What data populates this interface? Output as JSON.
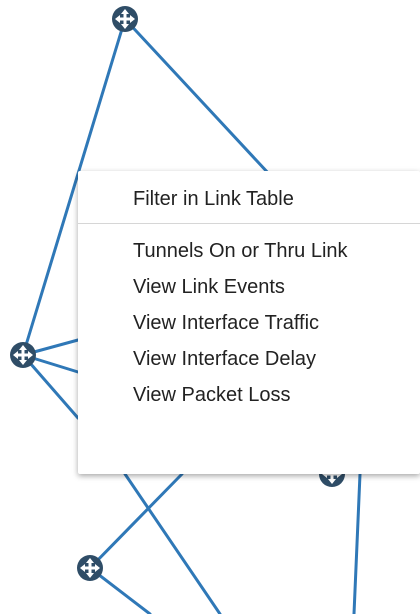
{
  "topology": {
    "link_color": "#2f78b7",
    "router_color": "#2f4d67",
    "router_icon": "router-icon"
  },
  "context_menu": {
    "primary_item": "Filter in Link Table",
    "items": [
      "Tunnels On or Thru Link",
      "View Link Events",
      "View Interface Traffic",
      "View Interface Delay",
      "View Packet Loss"
    ]
  }
}
